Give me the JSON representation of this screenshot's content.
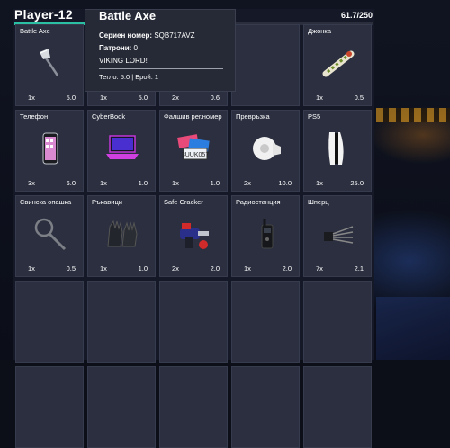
{
  "header": {
    "player_name": "Player-12",
    "weight": "61.7/250",
    "weight_fraction": 0.247
  },
  "tooltip": {
    "title": "Battle Axe",
    "serial_label": "Сериен номер:",
    "serial_value": "SQB717AVZ",
    "ammo_label": "Патрони:",
    "ammo_value": "0",
    "engraving": "VIKING LORD!",
    "stats": "Тегло: 5.0 | Брой: 1"
  },
  "slots": [
    {
      "label": "Battle Axe",
      "count": "1x",
      "weight": "5.0",
      "icon": "axe-icon"
    },
    {
      "label": "",
      "count": "1x",
      "weight": "5.0",
      "icon": "axe-icon"
    },
    {
      "label": "",
      "count": "2x",
      "weight": "0.6",
      "icon": "item-icon"
    },
    {
      "label": "",
      "count": "",
      "weight": "",
      "icon": ""
    },
    {
      "label": "Джонка",
      "count": "1x",
      "weight": "0.5",
      "icon": "joint-icon"
    },
    {
      "label": "Телефон",
      "count": "3x",
      "weight": "6.0",
      "icon": "phone-icon"
    },
    {
      "label": "CyberBook",
      "count": "1x",
      "weight": "1.0",
      "icon": "laptop-icon"
    },
    {
      "label": "Фалшив рег.номер",
      "count": "1x",
      "weight": "1.0",
      "icon": "license-plate-icon"
    },
    {
      "label": "Превръзка",
      "count": "2x",
      "weight": "10.0",
      "icon": "bandage-icon"
    },
    {
      "label": "PS5",
      "count": "1x",
      "weight": "25.0",
      "icon": "console-icon"
    },
    {
      "label": "Свинска опашка",
      "count": "1x",
      "weight": "0.5",
      "icon": "zip-tie-icon"
    },
    {
      "label": "Ръкавици",
      "count": "1x",
      "weight": "1.0",
      "icon": "gloves-icon"
    },
    {
      "label": "Safe Cracker",
      "count": "2x",
      "weight": "2.0",
      "icon": "drill-icon"
    },
    {
      "label": "Радиостанция",
      "count": "1x",
      "weight": "2.0",
      "icon": "radio-icon"
    },
    {
      "label": "Шперц",
      "count": "7x",
      "weight": "2.1",
      "icon": "lockpick-icon"
    },
    {
      "label": "",
      "count": "",
      "weight": "",
      "icon": ""
    },
    {
      "label": "",
      "count": "",
      "weight": "",
      "icon": ""
    },
    {
      "label": "",
      "count": "",
      "weight": "",
      "icon": ""
    },
    {
      "label": "",
      "count": "",
      "weight": "",
      "icon": ""
    },
    {
      "label": "",
      "count": "",
      "weight": "",
      "icon": ""
    },
    {
      "label": "",
      "count": "",
      "weight": "",
      "icon": ""
    },
    {
      "label": "",
      "count": "",
      "weight": "",
      "icon": ""
    },
    {
      "label": "",
      "count": "",
      "weight": "",
      "icon": ""
    },
    {
      "label": "",
      "count": "",
      "weight": "",
      "icon": ""
    },
    {
      "label": "",
      "count": "",
      "weight": "",
      "icon": ""
    }
  ]
}
